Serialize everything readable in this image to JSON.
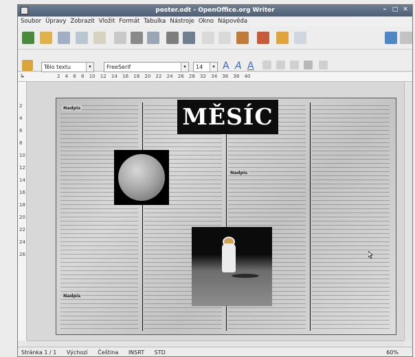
{
  "window": {
    "title": "poster.odt - OpenOffice.org Writer"
  },
  "menu": [
    "Soubor",
    "Úpravy",
    "Zobrazit",
    "Vložit",
    "Formát",
    "Tabulka",
    "Nástroje",
    "Okno",
    "Nápověda"
  ],
  "formatting": {
    "style": "Tělo textu",
    "font": "FreeSerif",
    "size": "14"
  },
  "ruler": {
    "marks": "2 4 6 8 10 12 14 16 18 20 22 24 26 28 32 34 36 38 40"
  },
  "vruler": {
    "nums": [
      "2",
      "4",
      "6",
      "8",
      "10",
      "12",
      "14",
      "16",
      "18",
      "20",
      "22",
      "24",
      "26"
    ]
  },
  "document": {
    "masthead": "MĚSÍC",
    "headings": {
      "col1_top": "Nadpis",
      "col1_bottom": "Nadpis",
      "col3": "Nadpis"
    }
  },
  "status": {
    "page": "Stránka 1 / 1",
    "style": "Výchozí",
    "lang": "Čeština",
    "mode": "INSRT",
    "sel": "STD",
    "zoom": "60%"
  }
}
